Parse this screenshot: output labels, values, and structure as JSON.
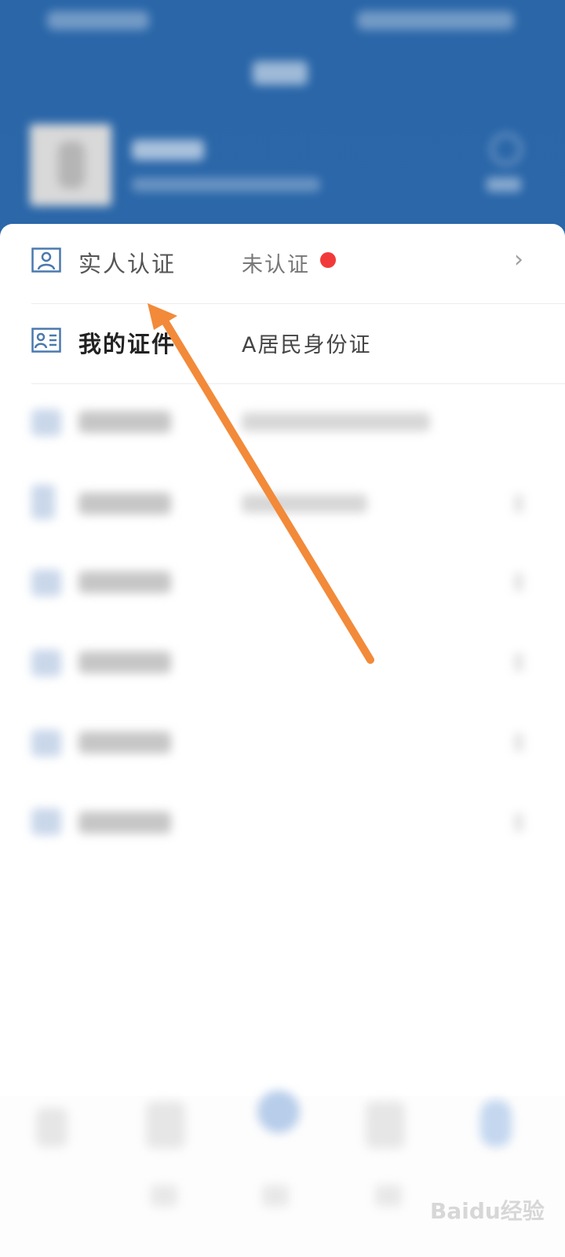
{
  "list": {
    "rows": [
      {
        "label": "实人认证",
        "value": "未认证",
        "icon": "person-card-icon",
        "status_color": "#f2393a"
      },
      {
        "label": "我的证件",
        "value": "A居民身份证",
        "icon": "id-card-icon"
      }
    ],
    "chevron": "›"
  },
  "watermark": "Baidu经验",
  "colors": {
    "header": "#2a66a8",
    "accent_arrow": "#f28a3a",
    "dot": "#f2393a"
  }
}
